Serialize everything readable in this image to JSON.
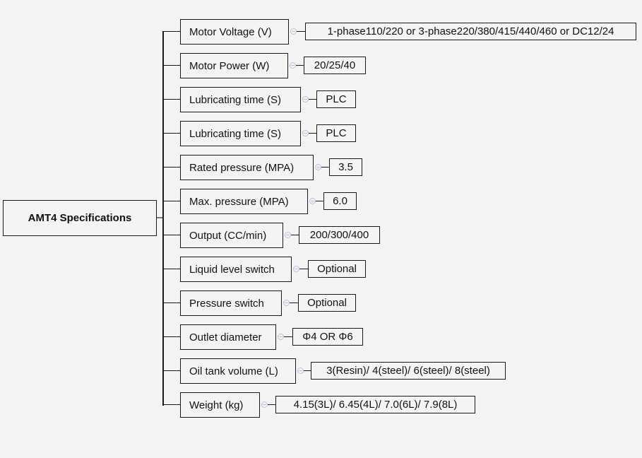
{
  "root": {
    "label": "AMT4 Specifications"
  },
  "specs": [
    {
      "label": "Motor Voltage (V)",
      "value": "1-phase110/220 or 3-phase220/380/415/440/460 or DC12/24"
    },
    {
      "label": "Motor Power (W)",
      "value": "20/25/40"
    },
    {
      "label": "Lubricating time (S)",
      "value": "PLC"
    },
    {
      "label": "Lubricating time (S)",
      "value": "PLC"
    },
    {
      "label": "Rated pressure (MPA)",
      "value": "3.5"
    },
    {
      "label": "Max. pressure (MPA)",
      "value": "6.0"
    },
    {
      "label": "Output (CC/min)",
      "value": "200/300/400"
    },
    {
      "label": "Liquid level switch",
      "value": "Optional"
    },
    {
      "label": "Pressure switch",
      "value": "Optional"
    },
    {
      "label": "Outlet diameter",
      "value": "Φ4 OR Φ6"
    },
    {
      "label": "Oil tank volume (L)",
      "value": "3(Resin)/ 4(steel)/ 6(steel)/ 8(steel)"
    },
    {
      "label": "Weight (kg)",
      "value": "4.15(3L)/ 6.45(4L)/ 7.0(6L)/ 7.9(8L)"
    }
  ],
  "icons": {
    "collapse": "collapse-minus-icon"
  }
}
